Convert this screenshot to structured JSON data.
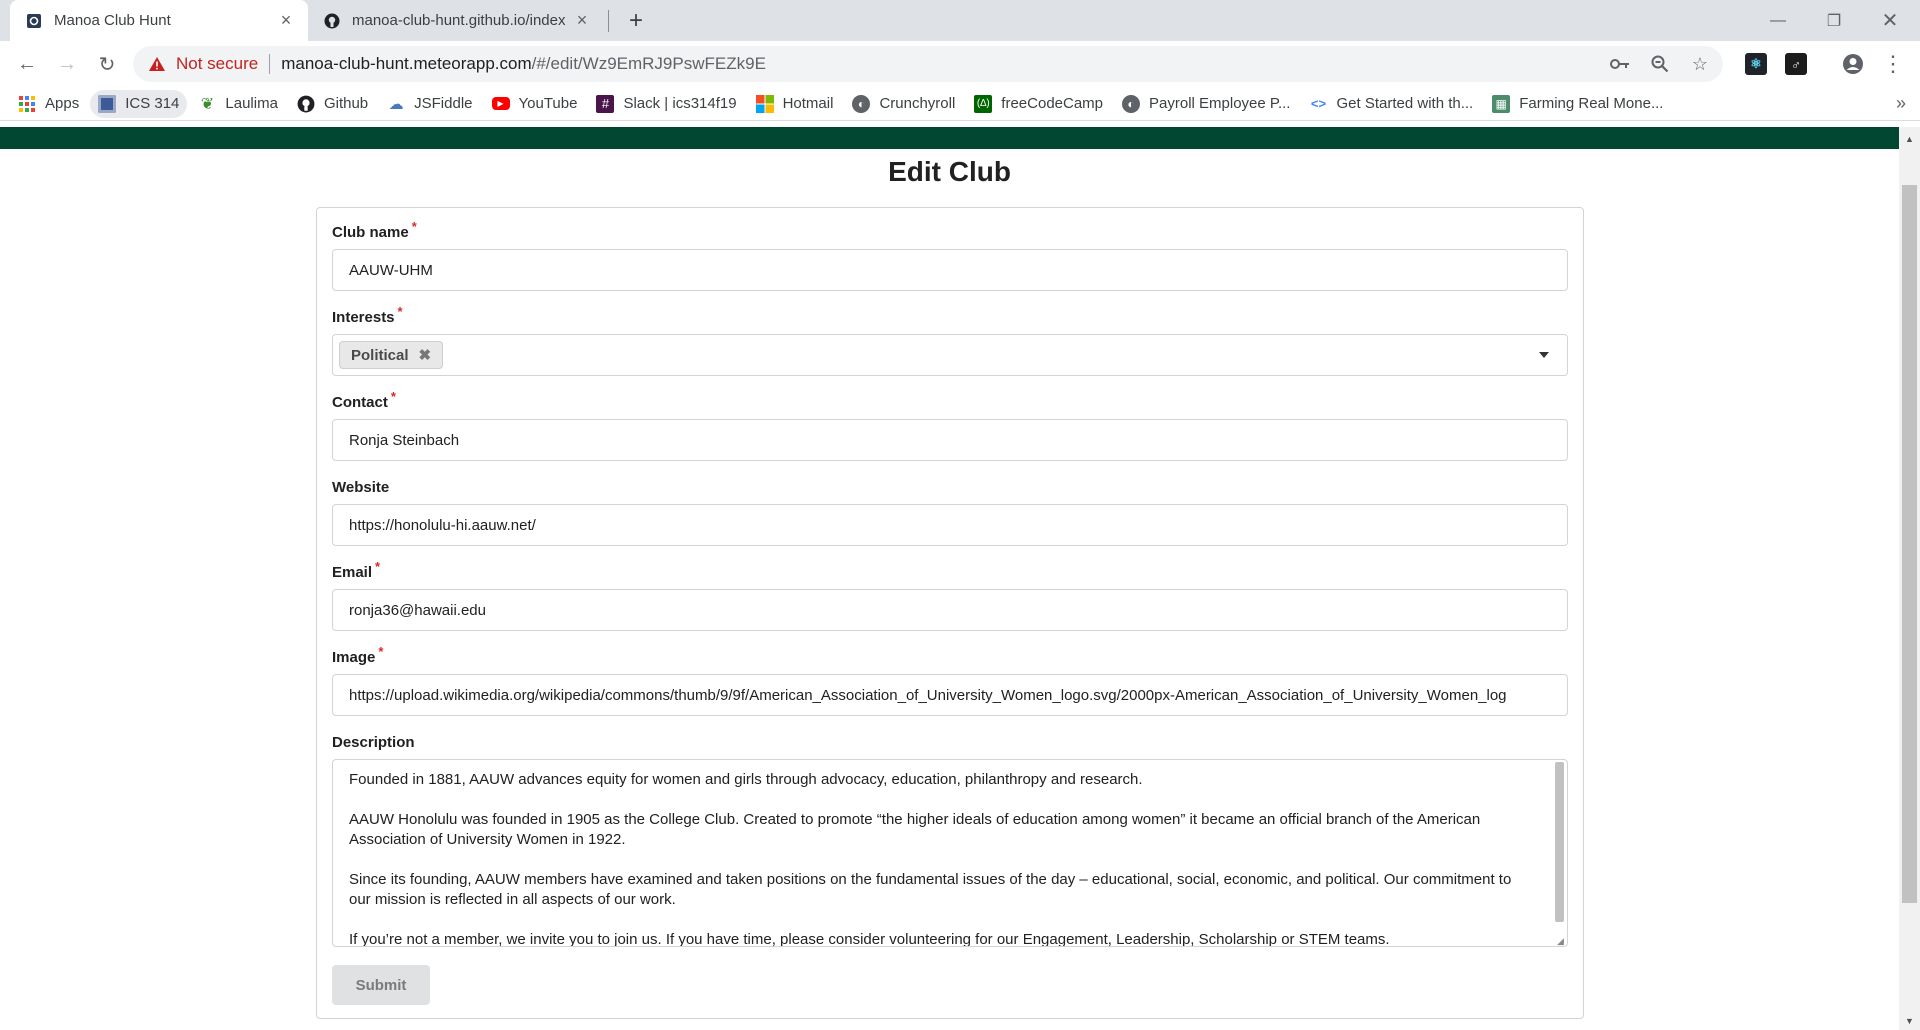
{
  "browser": {
    "tabs": [
      {
        "title": "Manoa Club Hunt",
        "active": true
      },
      {
        "title": "manoa-club-hunt.github.io/index",
        "active": false
      }
    ],
    "security_label": "Not secure",
    "url_host": "manoa-club-hunt.meteorapp.com",
    "url_path": "/#/edit/Wz9EmRJ9PswFEZk9E",
    "bookmarks": [
      {
        "label": "Apps",
        "icon": "apps-grid-icon"
      },
      {
        "label": "ICS 314",
        "icon": "folder-icon"
      },
      {
        "label": "Laulima",
        "icon": "leaf-icon"
      },
      {
        "label": "Github",
        "icon": "github-icon"
      },
      {
        "label": "JSFiddle",
        "icon": "cloud-icon"
      },
      {
        "label": "YouTube",
        "icon": "youtube-icon"
      },
      {
        "label": "Slack | ics314f19",
        "icon": "slack-icon"
      },
      {
        "label": "Hotmail",
        "icon": "windows-icon"
      },
      {
        "label": "Crunchyroll",
        "icon": "globe-icon"
      },
      {
        "label": "freeCodeCamp",
        "icon": "fcc-icon"
      },
      {
        "label": "Payroll Employee P...",
        "icon": "globe-icon"
      },
      {
        "label": "Get Started with th...",
        "icon": "code-icon"
      },
      {
        "label": "Farming Real Mone...",
        "icon": "game-icon"
      }
    ],
    "colors": {
      "header_green": "#024731",
      "warning_red": "#c5221f"
    }
  },
  "page": {
    "title": "Edit Club"
  },
  "form": {
    "club_name": {
      "label": "Club name",
      "required": "*",
      "value": "AAUW-UHM"
    },
    "interests": {
      "label": "Interests",
      "required": "*",
      "selected": "Political",
      "remove_glyph": "✖"
    },
    "contact": {
      "label": "Contact",
      "required": "*",
      "value": "Ronja Steinbach"
    },
    "website": {
      "label": "Website",
      "value": "https://honolulu-hi.aauw.net/"
    },
    "email": {
      "label": "Email",
      "required": "*",
      "value": "ronja36@hawaii.edu"
    },
    "image": {
      "label": "Image",
      "required": "*",
      "value": "https://upload.wikimedia.org/wikipedia/commons/thumb/9/9f/American_Association_of_University_Women_logo.svg/2000px-American_Association_of_University_Women_log"
    },
    "description": {
      "label": "Description",
      "paragraphs": [
        "Founded in 1881, AAUW advances equity for women and girls through advocacy, education, philanthropy and research.",
        "AAUW Honolulu was founded in 1905 as the College Club. Created to promote “the higher ideals of education among women” it became an official branch of the American Association of University Women in 1922.",
        "Since its founding, AAUW members have examined and taken positions on the fundamental issues of the day – educational, social, economic, and political. Our commitment to our mission is reflected in all aspects of our work.",
        "If you’re not a member, we invite you to join us. If you have time, please consider volunteering for our Engagement, Leadership, Scholarship or STEM teams."
      ]
    },
    "submit_label": "Submit"
  }
}
